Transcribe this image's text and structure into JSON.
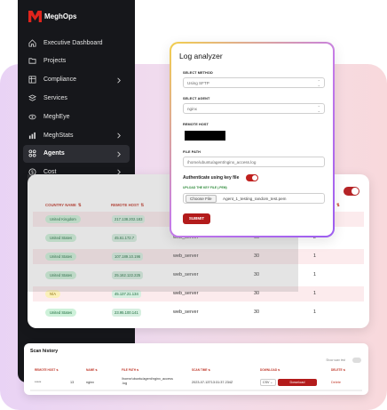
{
  "brand": {
    "name": "MeghOps",
    "accent": "#b31b1b"
  },
  "sidebar": {
    "items": [
      {
        "label": "Executive Dashboard",
        "icon": "home-icon",
        "chevron": false
      },
      {
        "label": "Projects",
        "icon": "folder-icon",
        "chevron": false
      },
      {
        "label": "Compliance",
        "icon": "grid-icon",
        "chevron": true
      },
      {
        "label": "Services",
        "icon": "layers-icon",
        "chevron": false
      },
      {
        "label": "MeghEye",
        "icon": "eye-icon",
        "chevron": false
      },
      {
        "label": "MeghStats",
        "icon": "bar-chart-icon",
        "chevron": true
      },
      {
        "label": "Agents",
        "icon": "agents-icon",
        "chevron": true,
        "active": true
      },
      {
        "label": "Cost",
        "icon": "dollar-icon",
        "chevron": true
      }
    ]
  },
  "agents_table": {
    "headers": [
      "COUNTRY NAME",
      "REMOTE HOST",
      ""
    ],
    "rows": [
      {
        "country": "United Kingdom",
        "country_color": "green",
        "ip": "217.138.202.183",
        "agent": "web_server",
        "a": "",
        "b": ""
      },
      {
        "country": "United States",
        "country_color": "green",
        "ip": "45.61.172.7",
        "agent": "web_server",
        "a": "60",
        "b": "2"
      },
      {
        "country": "United States",
        "country_color": "green",
        "ip": "107.189.10.196",
        "agent": "web_server",
        "a": "30",
        "b": "1"
      },
      {
        "country": "United States",
        "country_color": "green",
        "ip": "25.162.122.225",
        "agent": "web_server",
        "a": "30",
        "b": "1"
      },
      {
        "country": "N/A",
        "country_color": "yellow",
        "ip": "45.137.21.134",
        "agent": "web_server",
        "a": "30",
        "b": "1"
      },
      {
        "country": "United States",
        "country_color": "green",
        "ip": "23.95.100.141",
        "agent": "web_server",
        "a": "30",
        "b": "1"
      }
    ]
  },
  "log_analyzer": {
    "title": "Log analyzer",
    "select_method_label": "SELECT METHOD",
    "select_method_value": "Using SFTP",
    "select_agent_label": "SELECT AGENT",
    "select_agent_value": "nginx",
    "remote_host_label": "REMOTE HOST",
    "file_path_label": "FILE PATH",
    "file_path_value": "/home/ubuntu/agent/nginx_access.log",
    "auth_label": "Authenticate using key file",
    "auth_enabled": true,
    "upload_label": "UPLOAD THE KEY FILE (.PEM)",
    "choose_file_label": "Choose File",
    "file_name": "Agent_1_testing_random_test.pem",
    "submit_label": "SUBMIT"
  },
  "scan_history": {
    "title": "Scan history",
    "toggle_label": "Show scan test",
    "headers": [
      "REMOTE HOST",
      "NAME",
      "FILE PATH",
      "SCAN TIME",
      "DOWNLOAD",
      "DELETE"
    ],
    "row": {
      "host": "*****",
      "id": "13",
      "name": "nginx",
      "path_line1": "/home/ubuntu/agent/nginx_access",
      "path_line2": ".log",
      "time": "2023-07-13T13:31:37.234Z",
      "format": "CSV",
      "download": "Download",
      "delete": "Delete"
    }
  }
}
